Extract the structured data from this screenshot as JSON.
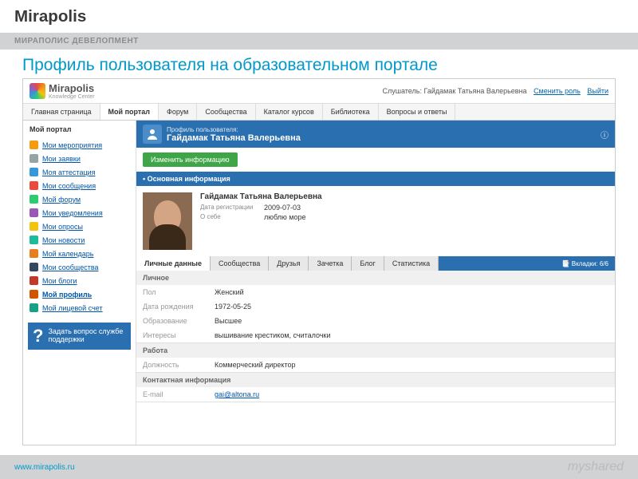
{
  "brand": "Mirapolis",
  "gray_bar": "МИРАПОЛИС ДЕВЕЛОПМЕНТ",
  "page_title": "Профиль пользователя на образовательном портале",
  "app_logo": {
    "name": "Mirapolis",
    "sub": "Knowledge Center"
  },
  "user_bar": {
    "label": "Слушатель:",
    "name": "Гайдамак Татьяна Валерьевна",
    "change_role": "Сменить роль",
    "logout": "Выйти"
  },
  "nav": [
    "Главная страница",
    "Мой портал",
    "Форум",
    "Сообщества",
    "Каталог курсов",
    "Библиотека",
    "Вопросы и ответы"
  ],
  "nav_active": 1,
  "sidebar": {
    "title": "Мой портал",
    "items": [
      {
        "label": "Мои мероприятия",
        "color": "#f39c12"
      },
      {
        "label": "Мои заявки",
        "color": "#95a5a6"
      },
      {
        "label": "Моя аттестация",
        "color": "#3498db"
      },
      {
        "label": "Мои сообщения",
        "color": "#e74c3c"
      },
      {
        "label": "Мой форум",
        "color": "#2ecc71"
      },
      {
        "label": "Мои уведомления",
        "color": "#9b59b6"
      },
      {
        "label": "Мои опросы",
        "color": "#f1c40f"
      },
      {
        "label": "Мои новости",
        "color": "#1abc9c"
      },
      {
        "label": "Мой календарь",
        "color": "#e67e22"
      },
      {
        "label": "Мои сообщества",
        "color": "#34495e"
      },
      {
        "label": "Мои блоги",
        "color": "#c0392b"
      },
      {
        "label": "Мой профиль",
        "color": "#d35400",
        "bold": true
      },
      {
        "label": "Мой лицевой счет",
        "color": "#16a085"
      }
    ],
    "support": "Задать вопрос службе поддержки"
  },
  "profile": {
    "header_sub": "Профиль пользователя:",
    "header_name": "Гайдамак Татьяна Валерьевна",
    "edit_btn": "Изменить информацию",
    "section_title": "• Основная информация",
    "name": "Гайдамак Татьяна Валерьевна",
    "reg_label": "Дата регистрации",
    "reg_date": "2009-07-03",
    "about_label": "О себе",
    "about": "люблю море",
    "tabs": [
      "Личные данные",
      "Сообщества",
      "Друзья",
      "Зачетка",
      "Блог",
      "Статистика"
    ],
    "tab_count": "Вкладки: 6/6",
    "sections": [
      {
        "title": "Личное",
        "rows": [
          {
            "label": "Пол",
            "val": "Женский"
          },
          {
            "label": "Дата рождения",
            "val": "1972-05-25"
          },
          {
            "label": "Образование",
            "val": "Высшее"
          },
          {
            "label": "Интересы",
            "val": "вышивание крестиком, считалочки"
          }
        ]
      },
      {
        "title": "Работа",
        "rows": [
          {
            "label": "Должность",
            "val": "Коммерческий директор"
          }
        ]
      },
      {
        "title": "Контактная информация",
        "rows": [
          {
            "label": "E-mail",
            "val": "gai@altona.ru",
            "link": true
          }
        ]
      }
    ]
  },
  "footer": {
    "url": "www.mirapolis.ru",
    "logo": "myshared"
  }
}
